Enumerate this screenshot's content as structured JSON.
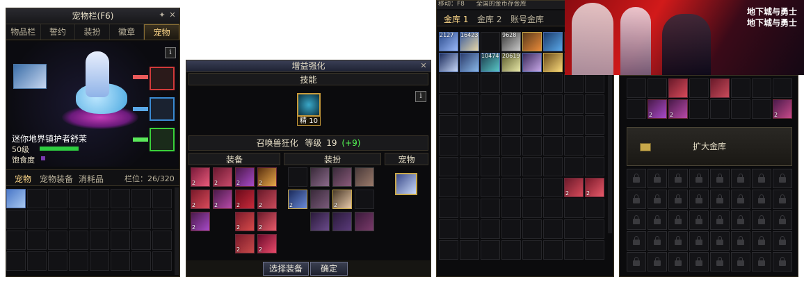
{
  "pet_window": {
    "title": "宠物栏(F6)",
    "tabs": [
      "物品栏",
      "誓约",
      "装扮",
      "徽章",
      "宠物"
    ],
    "active_tab": "宠物",
    "pet_name": "迷你地界镇护者舒茉",
    "level": "50级",
    "hunger_label": "饱食度",
    "sub_tabs": [
      "宠物",
      "宠物装备",
      "消耗品"
    ],
    "slot_count_label": "栏位：26/320",
    "info_icon": "i"
  },
  "buff_window": {
    "title": "增益强化",
    "skill_header": "技能",
    "skill_level_text": "精 10",
    "skill_name": "召唤兽狂化",
    "level_label": "等级",
    "level_value": "19",
    "level_bonus": "(+9)",
    "section_equipment": "装备",
    "section_avatar": "装扮",
    "section_pet": "宠物",
    "select_button": "选择装备",
    "confirm_button": "确定",
    "info_icon": "i"
  },
  "vault_window": {
    "top_text": "移动：F8",
    "top_text2": "全国的金币存金库",
    "tabs": [
      "金库 1",
      "金库 2",
      "账号金库"
    ],
    "item_counts": [
      "2127",
      "16423",
      "9628",
      "10474",
      "20619"
    ]
  },
  "game_banner": {
    "logo_text": "地下城与勇士"
  },
  "account_vault": {
    "expand_button": "扩大金库"
  },
  "colors": {
    "panel_bg": "#0b0b0d",
    "accent_gold": "#ffd98a",
    "level_bonus_green": "#55ff55",
    "hp_bar_green": "#2ecc40"
  }
}
